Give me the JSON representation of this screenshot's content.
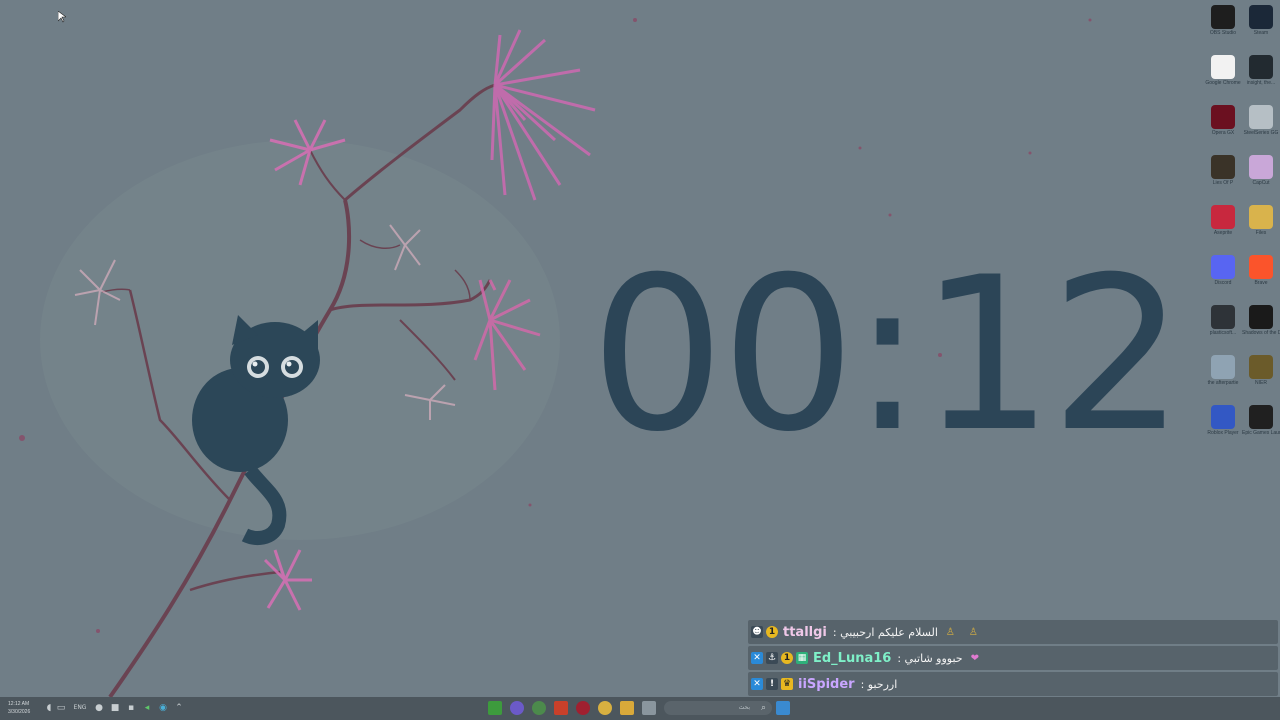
{
  "clock": {
    "text": "00:12"
  },
  "desktop_icons": [
    {
      "name": "OBS Studio",
      "icon": "obs-icon",
      "color": "#1e1e1e"
    },
    {
      "name": "Steam",
      "icon": "steam-icon",
      "color": "#1b2838"
    },
    {
      "name": "Google Chrome",
      "icon": "chrome-icon",
      "color": "#f2f2f2"
    },
    {
      "name": "insight, the...",
      "icon": "game-icon",
      "color": "#222a30"
    },
    {
      "name": "Opera GX",
      "icon": "opera-gx-icon",
      "color": "#6b1020"
    },
    {
      "name": "SteelSeries GG",
      "icon": "steelseries-icon",
      "color": "#b6bfc5"
    },
    {
      "name": "Lies Of P",
      "icon": "lies-of-p-icon",
      "color": "#3a3328"
    },
    {
      "name": "CapCut",
      "icon": "capcut-icon",
      "color": "#c9a7d8"
    },
    {
      "name": "Aseprite",
      "icon": "aseprite-icon",
      "color": "#c8283e"
    },
    {
      "name": "Files",
      "icon": "folder-icon",
      "color": "#d9b34c"
    },
    {
      "name": "Discord",
      "icon": "discord-icon",
      "color": "#5865f2"
    },
    {
      "name": "Brave",
      "icon": "brave-icon",
      "color": "#fb542b"
    },
    {
      "name": "plasticsoft...",
      "icon": "app-icon",
      "color": "#2e3338"
    },
    {
      "name": "Shadows of the Damn...",
      "icon": "shadows-icon",
      "color": "#1a1a1a"
    },
    {
      "name": "the afterpartie",
      "icon": "recycle-bin-icon",
      "color": "#8fa3b3"
    },
    {
      "name": "NIER",
      "icon": "nier-icon",
      "color": "#6b5b2a"
    },
    {
      "name": "Roblox Player",
      "icon": "roblox-icon",
      "color": "#3358c4"
    },
    {
      "name": "Epic Games Launcher",
      "icon": "epic-games-icon",
      "color": "#202020"
    }
  ],
  "chat": {
    "messages": [
      {
        "username": "ttallgi",
        "username_color": "#f0c8e8",
        "badges": [
          "moderator-badge",
          "sub-badge"
        ],
        "text": "السلام عليكم ارحبيبي :",
        "emotes": [
          "emote-icon",
          "emote-icon"
        ]
      },
      {
        "username": "Ed_Luna16",
        "username_color": "#7ff0c8",
        "badges": [
          "prime-badge",
          "moderator-badge",
          "sub-badge",
          "bits-badge"
        ],
        "text": "حبووو شاتبي :",
        "emotes": [
          "heart-emote-icon"
        ]
      },
      {
        "username": "iiSpider",
        "username_color": "#c9a6ff",
        "badges": [
          "prime-badge",
          "vip-badge",
          "crown-badge"
        ],
        "text": "اررحبو :",
        "emotes": []
      }
    ]
  },
  "taskbar": {
    "time": "12:12 AM",
    "date": "3/30/2026",
    "language": "ENG",
    "search_placeholder": "بحث"
  }
}
